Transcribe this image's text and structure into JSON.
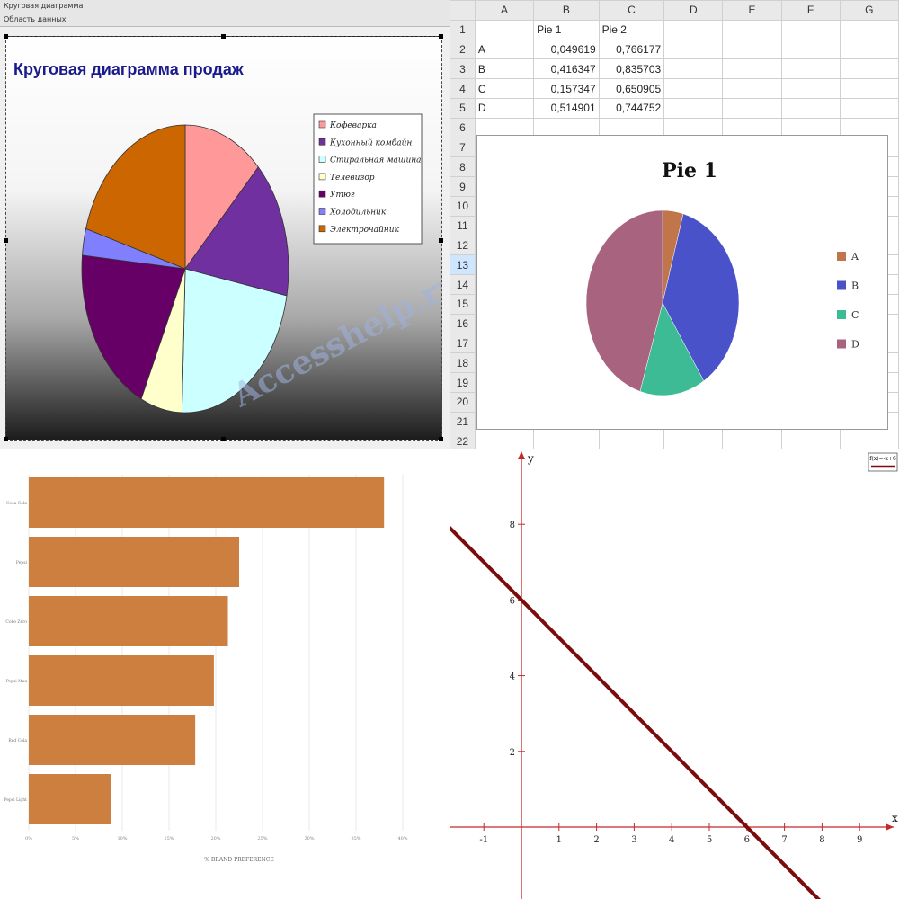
{
  "access_chart": {
    "toolbar_line1": "Круговая диаграмма",
    "toolbar_line2": "Область данных",
    "watermark": "Accesshelp.ru",
    "chart_data": {
      "type": "pie",
      "title": "Круговая диаграмма продаж",
      "legend_position": "right",
      "slices": [
        {
          "label": "Кофеварка",
          "value": 12.5,
          "color": "#ff9999"
        },
        {
          "label": "Кухонный комбайн",
          "value": 15.5,
          "color": "#7030a0"
        },
        {
          "label": "Стиральная машина",
          "value": 22.5,
          "color": "#ccffff"
        },
        {
          "label": "Телевизор",
          "value": 6.5,
          "color": "#ffffcc"
        },
        {
          "label": "Утюг",
          "value": 19.5,
          "color": "#660066"
        },
        {
          "label": "Холодильник",
          "value": 3.0,
          "color": "#8080ff"
        },
        {
          "label": "Электрочайник",
          "value": 20.5,
          "color": "#cc6600"
        }
      ]
    }
  },
  "sheet": {
    "columns": [
      "A",
      "B",
      "C",
      "D",
      "E",
      "F",
      "G"
    ],
    "selected_row": "13",
    "rows": [
      {
        "n": "1",
        "a": "",
        "b": "Pie 1",
        "c": "Pie 2"
      },
      {
        "n": "2",
        "a": "A",
        "b": "0,049619",
        "c": "0,766177"
      },
      {
        "n": "3",
        "a": "B",
        "b": "0,416347",
        "c": "0,835703"
      },
      {
        "n": "4",
        "a": "C",
        "b": "0,157347",
        "c": "0,650905"
      },
      {
        "n": "5",
        "a": "D",
        "b": "0,514901",
        "c": "0,744752"
      },
      {
        "n": "6"
      },
      {
        "n": "7"
      },
      {
        "n": "8"
      },
      {
        "n": "9"
      },
      {
        "n": "10"
      },
      {
        "n": "11"
      },
      {
        "n": "12"
      },
      {
        "n": "13"
      },
      {
        "n": "14"
      },
      {
        "n": "15"
      },
      {
        "n": "16"
      },
      {
        "n": "17"
      },
      {
        "n": "18"
      },
      {
        "n": "19"
      },
      {
        "n": "20"
      },
      {
        "n": "21"
      },
      {
        "n": "22"
      }
    ],
    "chart_data": {
      "type": "pie",
      "title": "Pie 1",
      "legend_position": "right",
      "slices": [
        {
          "label": "A",
          "value": 0.049619,
          "color": "#c0754a"
        },
        {
          "label": "B",
          "value": 0.416347,
          "color": "#4a52c9"
        },
        {
          "label": "C",
          "value": 0.157347,
          "color": "#3dbb94"
        },
        {
          "label": "D",
          "value": 0.514901,
          "color": "#a8637f"
        }
      ]
    }
  },
  "brand_chart": {
    "chart_data": {
      "type": "bar",
      "orientation": "horizontal",
      "xlabel": "% BRAND PREFERENCE",
      "categories": [
        "Coca Cola",
        "Pepsi",
        "Coke Zero",
        "Pepsi Max",
        "Red Cola",
        "Pepsi Light"
      ],
      "values": [
        38,
        22.5,
        21.3,
        19.8,
        17.8,
        8.8
      ],
      "ticks": [
        "0%",
        "5%",
        "10%",
        "15%",
        "20%",
        "25%",
        "30%",
        "35%",
        "40%"
      ],
      "xlim": [
        0,
        40
      ],
      "bar_color": "#cd7f40",
      "grid": true
    }
  },
  "function_plot": {
    "chart_data": {
      "type": "line",
      "xlabel": "x",
      "ylabel": "y",
      "xlim": [
        -1.5,
        9.9
      ],
      "ylim": [
        -2,
        9.8
      ],
      "x_ticks": [
        "-1",
        "1",
        "2",
        "3",
        "4",
        "5",
        "6",
        "7",
        "8",
        "9"
      ],
      "y_ticks": [
        "2",
        "4",
        "6",
        "8"
      ],
      "series": [
        {
          "name": "f(x)=-x+6",
          "x": [
            -2,
            8
          ],
          "y": [
            8,
            -2
          ],
          "color": "#7a0c0c"
        }
      ],
      "legend_position": "top-right"
    }
  }
}
